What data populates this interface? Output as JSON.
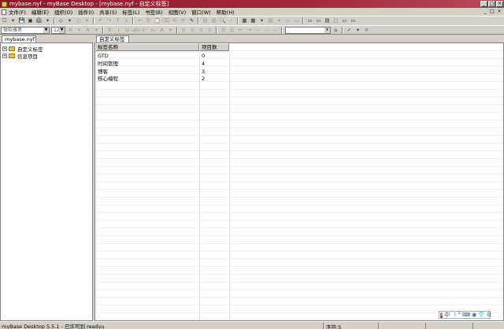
{
  "window": {
    "title": "mybase.nyf - myBase Desktop - [mybase.nyf - 自定义标签]",
    "buttons": [
      "_",
      "□",
      "×"
    ]
  },
  "menubar": {
    "items": [
      "文件(F)",
      "编辑(E)",
      "组织(O)",
      "插件(I)",
      "共享(S)",
      "标签(L)",
      "书签(B)",
      "视图(V)",
      "窗口(W)",
      "帮助(H)"
    ],
    "mdi_buttons": [
      "_",
      "□",
      "×"
    ]
  },
  "toolbar1": {
    "buttons": [
      "☐",
      "▾",
      "💾",
      "▣",
      "🖨",
      "▾",
      "◇",
      "▾",
      "○",
      "▾",
      "↶",
      "↷",
      "↑",
      "↓",
      "✂",
      "⎘",
      "📋",
      "⌫",
      "⟲",
      "⟳",
      "✎",
      "▤",
      "▥",
      "🔍",
      "›",
      "▦",
      "▦",
      "▾",
      "▤",
      "▾",
      "▭",
      "▭",
      "▭",
      "▭",
      "▤",
      "⬚",
      "▭",
      "▭",
      "▭",
      "▭"
    ]
  },
  "toolbar2": {
    "font_family": "微软雅黑",
    "font_size": "12",
    "buttons": [
      "A",
      "▾",
      "A",
      "▾",
      "B",
      "I",
      "U",
      "abc",
      "x²",
      "x₂",
      "A",
      "▾",
      "≡",
      "≡",
      "≡",
      "≡",
      "☰",
      "☰",
      "⇤",
      "⇥",
      "—",
      "—",
      "—"
    ],
    "heading_combo": "",
    "extra_buttons": [
      "▾",
      "⌂",
      "✓",
      "▾",
      "✖"
    ]
  },
  "left_panel": {
    "tab": "mybase.nyf",
    "tree": [
      {
        "label": "自定义标签",
        "expander": "+"
      },
      {
        "label": "信息项目",
        "expander": "+"
      }
    ]
  },
  "right_panel": {
    "tab": "自定义标签",
    "columns": [
      "标签名称",
      "项目数"
    ],
    "rows": [
      {
        "name": "GTD",
        "count": "0"
      },
      {
        "name": "时间管理",
        "count": "4"
      },
      {
        "name": "博客",
        "count": "3"
      },
      {
        "name": "核心编程",
        "count": "2"
      }
    ]
  },
  "statusbar": {
    "text": "myBase Desktop 5.5.1 - 已许可到 readyu",
    "count": "字符:5"
  },
  "ime": {
    "logo": "S",
    "lang": "中",
    "icons": [
      "☽",
      "°",
      "⌨",
      "◉",
      "👕",
      "⚙"
    ]
  },
  "colors": {
    "titlebar": "#8b1a2a",
    "face": "#d4d0c8",
    "grid_line": "#eeeeee"
  }
}
